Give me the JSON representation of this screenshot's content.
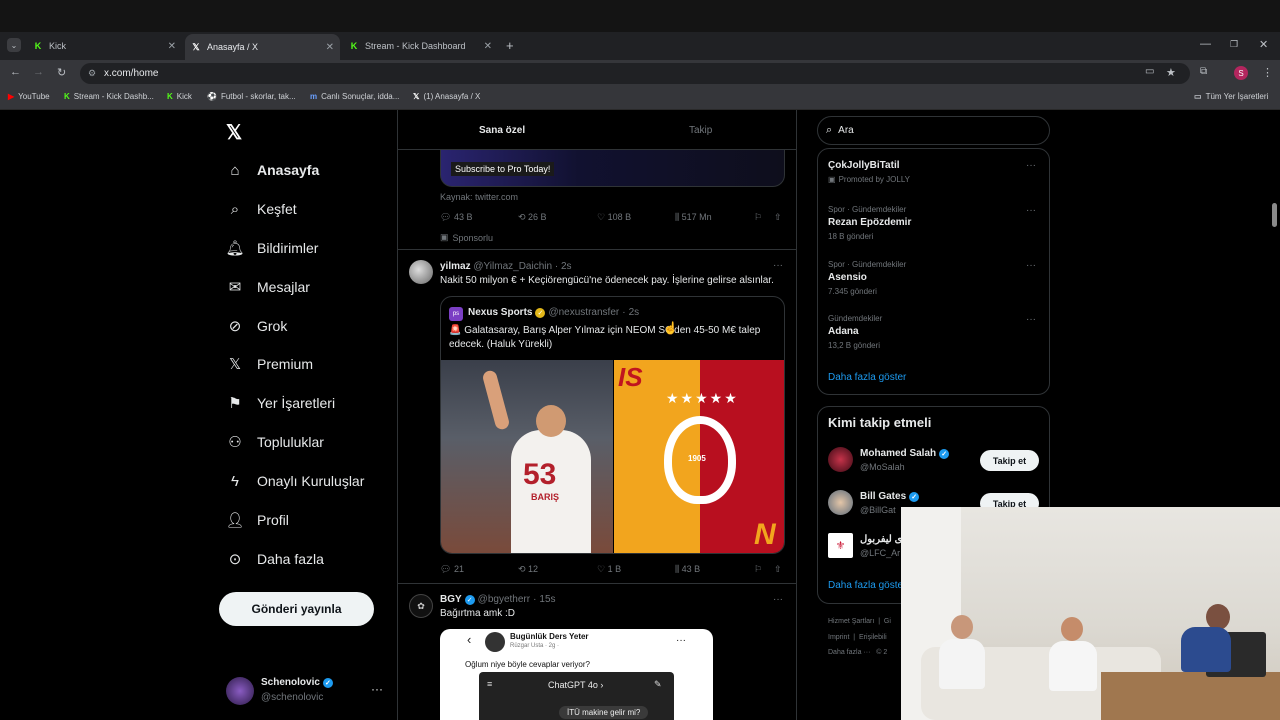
{
  "browser": {
    "tabs": [
      {
        "label": "Kick",
        "icon": "kick-icon"
      },
      {
        "label": "Anasayfa / X",
        "icon": "x-logo-icon"
      },
      {
        "label": "Stream - Kick Dashboard",
        "icon": "kick-icon"
      }
    ],
    "url": "x.com/home",
    "bookmarks": [
      {
        "label": "YouTube",
        "icon": "youtube-icon"
      },
      {
        "label": "Stream - Kick Dashb...",
        "icon": "kick-icon"
      },
      {
        "label": "Kick",
        "icon": "kick-icon"
      },
      {
        "label": "Futbol - skorlar, tak...",
        "icon": "football-icon"
      },
      {
        "label": "Canlı Sonuçlar, idda...",
        "icon": "m-icon"
      },
      {
        "label": "(1) Anasayfa / X",
        "icon": "x-logo-icon"
      }
    ],
    "all_bookmarks": "Tüm Yer İşaretleri",
    "profile_initial": "S"
  },
  "sidebar": {
    "items": [
      {
        "label": "Anasayfa",
        "icon": "home-icon"
      },
      {
        "label": "Keşfet",
        "icon": "search-icon"
      },
      {
        "label": "Bildirimler",
        "icon": "bell-icon"
      },
      {
        "label": "Mesajlar",
        "icon": "mail-icon"
      },
      {
        "label": "Grok",
        "icon": "grok-icon"
      },
      {
        "label": "Premium",
        "icon": "x-logo-icon"
      },
      {
        "label": "Yer İşaretleri",
        "icon": "bookmark-icon"
      },
      {
        "label": "Topluluklar",
        "icon": "communities-icon"
      },
      {
        "label": "Onaylı Kuruluşlar",
        "icon": "lightning-icon"
      },
      {
        "label": "Profil",
        "icon": "profile-icon"
      },
      {
        "label": "Daha fazla",
        "icon": "more-circle-icon"
      }
    ],
    "post_button": "Gönderi yayınla",
    "account": {
      "name": "Schenolovic",
      "handle": "@schenolovic"
    }
  },
  "feed": {
    "tabs": [
      "Sana özel",
      "Takip"
    ],
    "ad": {
      "button": "Subscribe to Pro Today!",
      "source": "Kaynak: twitter.com",
      "stats": {
        "replies": "43 B",
        "reposts": "26 B",
        "likes": "108 B",
        "views": "517 Mn"
      },
      "sponsored": "Sponsorlu"
    },
    "tweets": [
      {
        "name": "yilmaz",
        "handle": "@Yilmaz_Daichin",
        "time": "2s",
        "text": "Nakit 50 milyon € + Keçiörengücü'ne ödenecek pay. İşlerine gelirse alsınlar.",
        "quote": {
          "name": "Nexus Sports",
          "handle": "@nexustransfer",
          "time": "2s",
          "text": "🚨 Galatasaray, Barış Alper Yılmaz için NEOM SC'den 45-50 M€ talep edecek. (Haluk Yürekli)",
          "jersey_number": "53",
          "jersey_name": "BARIŞ",
          "crest_year": "1905"
        },
        "stats": {
          "replies": "21",
          "reposts": "12",
          "likes": "1 B",
          "views": "43 B"
        }
      },
      {
        "name": "BGY",
        "handle": "@bgyetherr",
        "time": "15s",
        "text": "Bağırtma amk :D",
        "embed": {
          "title": "Bugünlük Ders Yeter",
          "sub": "Rüzgar Usta · 2g ·",
          "question": "Oğlum niye böyle cevaplar veriyor?",
          "chat_title": "ChatGPT 4o",
          "chat_bubble": "İTÜ makine gelir mi?"
        }
      }
    ]
  },
  "right": {
    "search_placeholder": "Ara",
    "trends": [
      {
        "category": "",
        "name": "ÇokJollyBiTatil",
        "count": "Promoted by JOLLY"
      },
      {
        "category": "Spor · Gündemdekiler",
        "name": "Rezan Epözdemir",
        "count": "18 B gönderi"
      },
      {
        "category": "Spor · Gündemdekiler",
        "name": "Asensio",
        "count": "7.345 gönderi"
      },
      {
        "category": "Gündemdekiler",
        "name": "Adana",
        "count": "13,2 B gönderi"
      }
    ],
    "show_more": "Daha fazla göster",
    "who_to_follow_title": "Kimi takip etmeli",
    "who_to_follow": [
      {
        "name": "Mohamed Salah",
        "handle": "@MoSalah",
        "button": "Takip et"
      },
      {
        "name": "Bill Gates",
        "handle": "@BillGat",
        "button": "Takip et"
      },
      {
        "name": "ى ليفربول",
        "handle": "@LFC_Ar",
        "button": ""
      }
    ],
    "who_show_more": "Daha fazla göste",
    "footer": [
      "Hizmet Şartları",
      "|",
      "Gi",
      "Imprint",
      "|",
      "Erişilebili",
      "Daha fazla ···",
      "© 2"
    ]
  }
}
